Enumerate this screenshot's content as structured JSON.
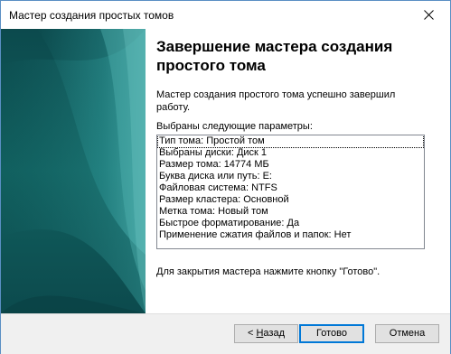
{
  "window": {
    "title": "Мастер создания простых томов",
    "close_icon": "close-icon"
  },
  "banner": {
    "colors": {
      "dark": "#0d4f52",
      "mid": "#1a7a7a",
      "light": "#2f9a9a"
    }
  },
  "content": {
    "heading": "Завершение мастера создания простого тома",
    "description": "Мастер создания простого тома успешно завершил работу.",
    "list_label": "Выбраны следующие параметры:",
    "summary": [
      "Тип тома: Простой том",
      "Выбраны диски: Диск 1",
      "Размер тома: 14774 МБ",
      "Буква диска или путь: E:",
      "Файловая система: NTFS",
      "Размер кластера: Основной",
      "Метка тома: Новый том",
      "Быстрое форматирование: Да",
      "Применение сжатия файлов и папок: Нет"
    ],
    "closing_hint": "Для закрытия мастера нажмите кнопку \"Готово\"."
  },
  "buttons": {
    "back_arrow": "< ",
    "back_mnemonic": "Н",
    "back_rest": "азад",
    "finish": "Готово",
    "cancel": "Отмена"
  },
  "colors": {
    "accent": "#0078d7",
    "window_border": "#5a8fc4",
    "footer_bg": "#f0f0f0"
  }
}
